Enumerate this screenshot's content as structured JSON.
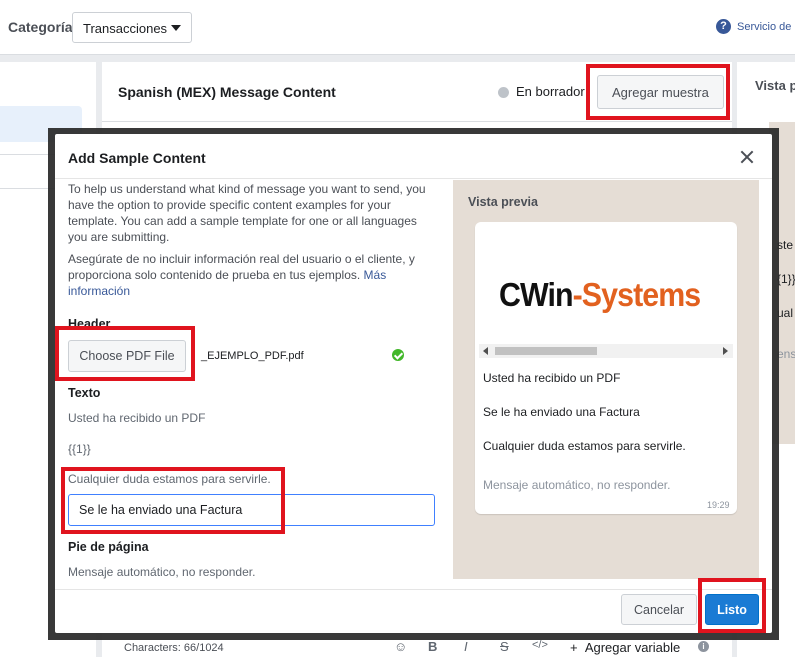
{
  "topbar": {
    "category_label": "Categoría",
    "category_value": "Transacciones",
    "help_text": "Servicio de"
  },
  "message_panel": {
    "title": "Spanish (MEX) Message Content",
    "status": "En borrador",
    "add_sample_label": "Agregar muestra",
    "characters": "Characters: 66/1024",
    "toolbar": {
      "bold": "B",
      "italic": "I",
      "strike": "S",
      "code": "</>",
      "add_variable": "Agregar variable"
    }
  },
  "right_panel": {
    "title": "Vista p",
    "fragments": [
      "ste",
      "{1}}",
      "ual",
      "ens"
    ]
  },
  "modal": {
    "title": "Add Sample Content",
    "intro": "To help us understand what kind of message you want to send, you have the option to provide specific content examples for your template. You can add a sample template for one or all languages you are submitting.",
    "note": "Asegúrate de no incluir información real del usuario o el cliente, y proporciona solo contenido de prueba en tus ejemplos.",
    "more_info": "Más información",
    "header_label": "Header",
    "choose_pdf_label": "Choose PDF File",
    "file_name": "_EJEMPLO_PDF.pdf",
    "text_label": "Texto",
    "text_lines": [
      "Usted ha recibido un PDF",
      "{{1}}",
      "Cualquier duda estamos para servirle."
    ],
    "sample_value": "Se le ha enviado una Factura",
    "footer_label": "Pie de página",
    "footer_text": "Mensaje automático, no responder.",
    "cancel_label": "Cancelar",
    "done_label": "Listo"
  },
  "preview": {
    "title": "Vista previa",
    "logo_part1": "CWin",
    "logo_part2": "-Systems",
    "line1": "Usted ha recibido un PDF",
    "line2": "Se le ha enviado una Factura",
    "line3": "Cualquier duda estamos para servirle.",
    "footer": "Mensaje automático, no responder.",
    "time": "19:29"
  },
  "colors": {
    "highlight": "#e0141e",
    "primary": "#1a7bd4",
    "link": "#385898",
    "success": "#42b72a",
    "preview_bg": "#e5ddd5"
  }
}
